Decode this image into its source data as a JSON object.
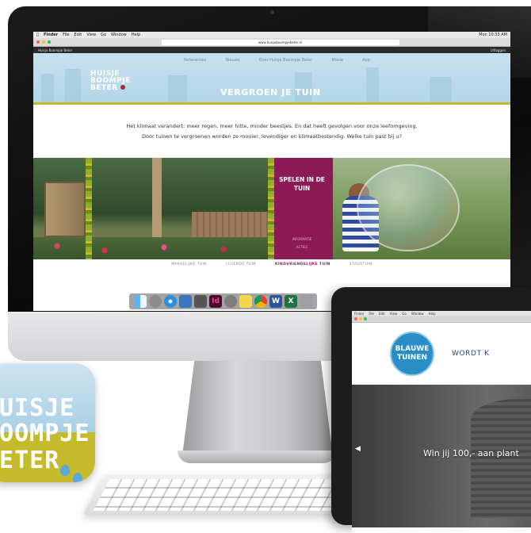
{
  "imac": {
    "menubar": {
      "app": "Finder",
      "items": [
        "File",
        "Edit",
        "View",
        "Go",
        "Window",
        "Help"
      ],
      "clock": "Mon 10:33 AM"
    },
    "browser": {
      "url": "www.huisjeboompjebeter.nl",
      "tab_title": "Huisje Boompje Beter",
      "account_link": "Uitloggen"
    },
    "site": {
      "nav": [
        "Referenties",
        "Nieuws",
        "Over Huisje Boompje Beter",
        "Movie",
        "App"
      ],
      "logo_lines": [
        "HUISJE",
        "BOOMPJE",
        "BETER"
      ],
      "title": "VERGROEN JE TUIN",
      "intro_line_1": "Het klimaat verandert: meer regen, meer hitte, minder beestjes. En dat heeft gevolgen voor onze leefomgeving.",
      "intro_line_2": "Door tuinen te vergroenen worden ze mooier, levendiger en klimaatbestendig. Welke tuin past bij u?",
      "feature": {
        "title_line_1": "SPELEN IN DE",
        "title_line_2": "TUIN",
        "link_1": "INFORMATIE",
        "link_2": "ACTIES"
      },
      "garden_tabs": [
        "MAKKELIJKE TUIN",
        "LEVENDE TUIN",
        "KINDVRIENDELIJKE TUIN",
        "STADSTUIN"
      ]
    },
    "dock_icons": [
      "finder-icon",
      "launchpad-icon",
      "safari-icon",
      "preview-icon",
      "notes-icon",
      "indesign-icon",
      "system-preferences-icon",
      "stickies-icon",
      "chrome-icon",
      "word-icon",
      "excel-icon",
      "trash-icon"
    ]
  },
  "app_icon": {
    "lines": [
      "HUISJE",
      "BOOMPJE",
      "BETER"
    ]
  },
  "tablet": {
    "menubar_items": [
      "Finder",
      "File",
      "Edit",
      "View",
      "Go",
      "Window",
      "Help"
    ],
    "logo_line_1": "BLAUWE",
    "logo_line_2": "TUINEN",
    "nav_text": "WORDT K",
    "headline": "Win jij 100,- aan plant"
  },
  "colors": {
    "sky_blue": "#b3d6e9",
    "accent_yellow": "#c7b92a",
    "magenta": "#8b1a56",
    "tablet_blue": "#2a8ec6"
  }
}
